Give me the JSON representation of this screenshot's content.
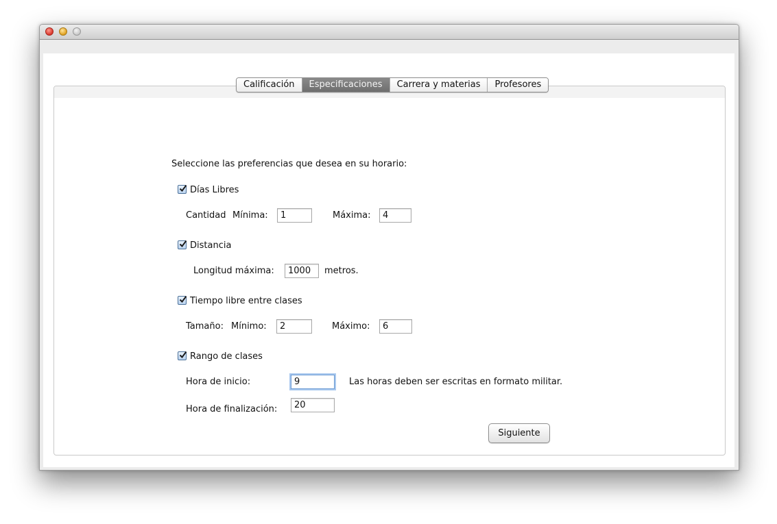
{
  "tabs": [
    "Calificación",
    "Especificaciones",
    "Carrera y materias",
    "Profesores"
  ],
  "active_tab": 1,
  "prompt": "Seleccione las preferencias que desea en su horario:",
  "free_days": {
    "checkbox_label": "Días Libres",
    "checked": true,
    "quantity_label": "Cantidad",
    "min_label": "Mínima:",
    "min_value": "1",
    "max_label": "Máxima:",
    "max_value": "4"
  },
  "distance": {
    "checkbox_label": "Distancia",
    "checked": true,
    "length_label": "Longitud máxima:",
    "length_value": "1000",
    "unit_label": "metros."
  },
  "free_time": {
    "checkbox_label": "Tiempo libre entre clases",
    "checked": true,
    "size_label": "Tamaño:",
    "min_label": "Mínimo:",
    "min_value": "2",
    "max_label": "Máximo:",
    "max_value": "6"
  },
  "class_range": {
    "checkbox_label": "Rango de clases",
    "checked": true,
    "start_label": "Hora de inicio:",
    "start_value": "9",
    "note": "Las horas deben ser escritas en formato militar.",
    "end_label": "Hora de finalización:",
    "end_value": "20"
  },
  "next_button": "Siguiente"
}
